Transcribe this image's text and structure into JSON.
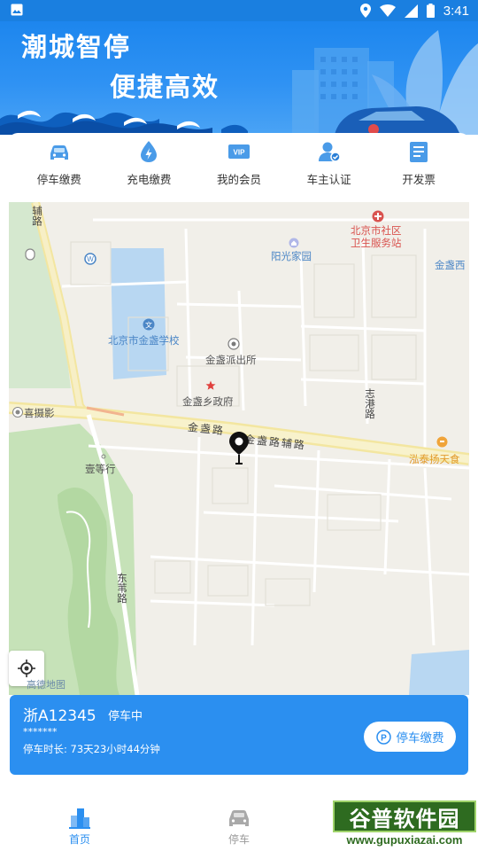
{
  "status_bar": {
    "time": "3:41"
  },
  "banner": {
    "line1": "潮城智停",
    "line2": "便捷高效"
  },
  "quick_menu": [
    {
      "label": "停车缴费",
      "icon": "car-icon"
    },
    {
      "label": "充电缴费",
      "icon": "charge-drop-icon"
    },
    {
      "label": "我的会员",
      "icon": "vip-icon"
    },
    {
      "label": "车主认证",
      "icon": "user-verify-icon"
    },
    {
      "label": "开发票",
      "icon": "invoice-icon"
    }
  ],
  "map": {
    "labels": {
      "fuzhu_lu": "辅路",
      "community_center_1": "北京市社区",
      "community_center_2": "卫生服务站",
      "yangguang_jiayuan": "阳光家园",
      "jinzhan_xi": "金盏西",
      "school": "北京市金盏学校",
      "police": "金盏派出所",
      "gov": "金盏乡政府",
      "zhigang_lu": "志港路",
      "xi_sheying": "喜摄影",
      "jinzhan_lu": "金盏路",
      "jinzhan_lu_fuzhu": "金盏路辅路",
      "hongtai": "泓泰扬天食",
      "yideng_hang": "壹等行",
      "dongwei_lu": "东苇路",
      "map_logo": "高德地图"
    }
  },
  "parking": {
    "plate": "浙A12345",
    "status": "停车中",
    "masked": "*******",
    "duration": "停车时长: 73天23小时44分钟",
    "pay_button": "停车缴费"
  },
  "bottom_nav": {
    "home": "首页",
    "parking": "停车"
  },
  "watermark": {
    "title": "谷普软件园",
    "url": "www.gupuxiazai.com"
  },
  "colors": {
    "accent": "#2b8ff0",
    "banner": "#1d86ee",
    "park_card": "#2b8ff0"
  }
}
